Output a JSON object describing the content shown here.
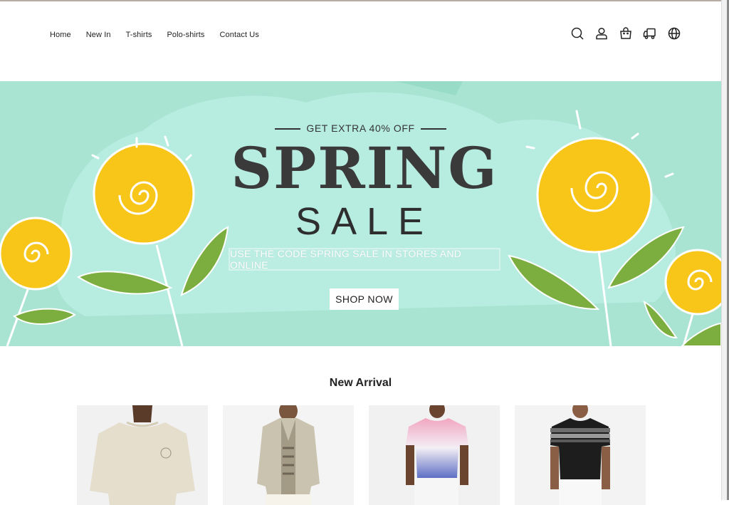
{
  "header": {
    "nav": [
      {
        "id": "home",
        "label": "Home"
      },
      {
        "id": "new-in",
        "label": "New In"
      },
      {
        "id": "t-shirts",
        "label": "T-shirts"
      },
      {
        "id": "polo-shirts",
        "label": "Polo-shirts"
      },
      {
        "id": "contact-us",
        "label": "Contact Us"
      }
    ],
    "icons": [
      "search-icon",
      "user-icon",
      "shopping-bag-icon",
      "delivery-truck-icon",
      "globe-icon"
    ]
  },
  "hero": {
    "promo": "GET EXTRA 40% OFF",
    "title": "SPRING",
    "subtitle": "SALE",
    "code_text": "USE THE CODE SPRING SALE IN STORES AND ONLINE",
    "cta": "SHOP NOW",
    "colors": {
      "background": "#a9e4d3",
      "flower": "#f7c619",
      "leaf": "#7cae3f"
    }
  },
  "new_arrival": {
    "title": "New Arrival",
    "products": [
      {
        "name": "cream-tshirt",
        "colors": {
          "shirt": "#e5decd",
          "skin": "#5a3b2a"
        }
      },
      {
        "name": "khaki-overshirt",
        "colors": {
          "shirt": "#c9c3af",
          "skin": "#7a563f"
        }
      },
      {
        "name": "pink-blue-ombre-tshirt",
        "colors": {
          "shirt": "#f2a6c0",
          "skin": "#6b4430"
        }
      },
      {
        "name": "black-striped-tshirt",
        "colors": {
          "shirt": "#1d1d1d",
          "skin": "#8a5e44"
        }
      }
    ]
  }
}
